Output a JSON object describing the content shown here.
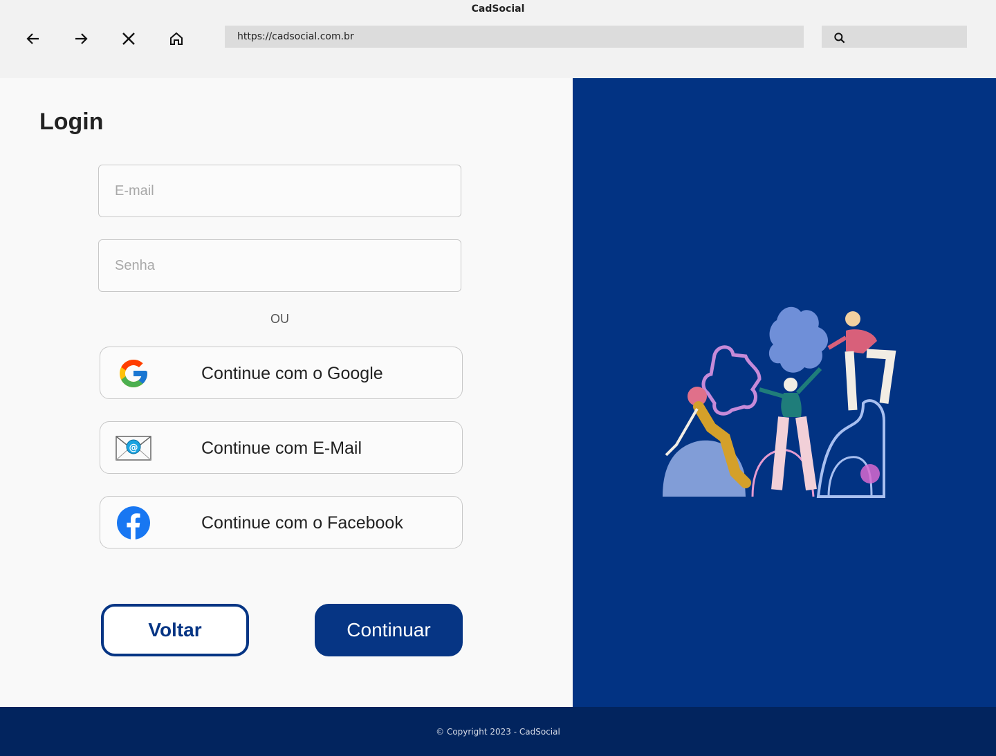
{
  "browser": {
    "window_title": "CadSocial",
    "url": "https://cadsocial.com.br",
    "nav_icons": [
      "back-arrow-icon",
      "forward-arrow-icon",
      "close-icon",
      "home-icon"
    ],
    "search_icon": "search-icon"
  },
  "login": {
    "title": "Login",
    "email_placeholder": "E-mail",
    "password_placeholder": "Senha",
    "or_label": "OU",
    "social_buttons": [
      {
        "label": "Continue com o Google",
        "icon": "google-icon"
      },
      {
        "label": "Continue com E-Mail",
        "icon": "email-envelope-icon"
      },
      {
        "label": "Continue com o Facebook",
        "icon": "facebook-icon"
      }
    ],
    "back_label": "Voltar",
    "continue_label": "Continuar"
  },
  "colors": {
    "brand_blue": "#063584",
    "panel_blue": "#023383",
    "footer_blue": "#02245e"
  },
  "footer": {
    "copyright": "© Copyright 2023 - CadSocial"
  }
}
